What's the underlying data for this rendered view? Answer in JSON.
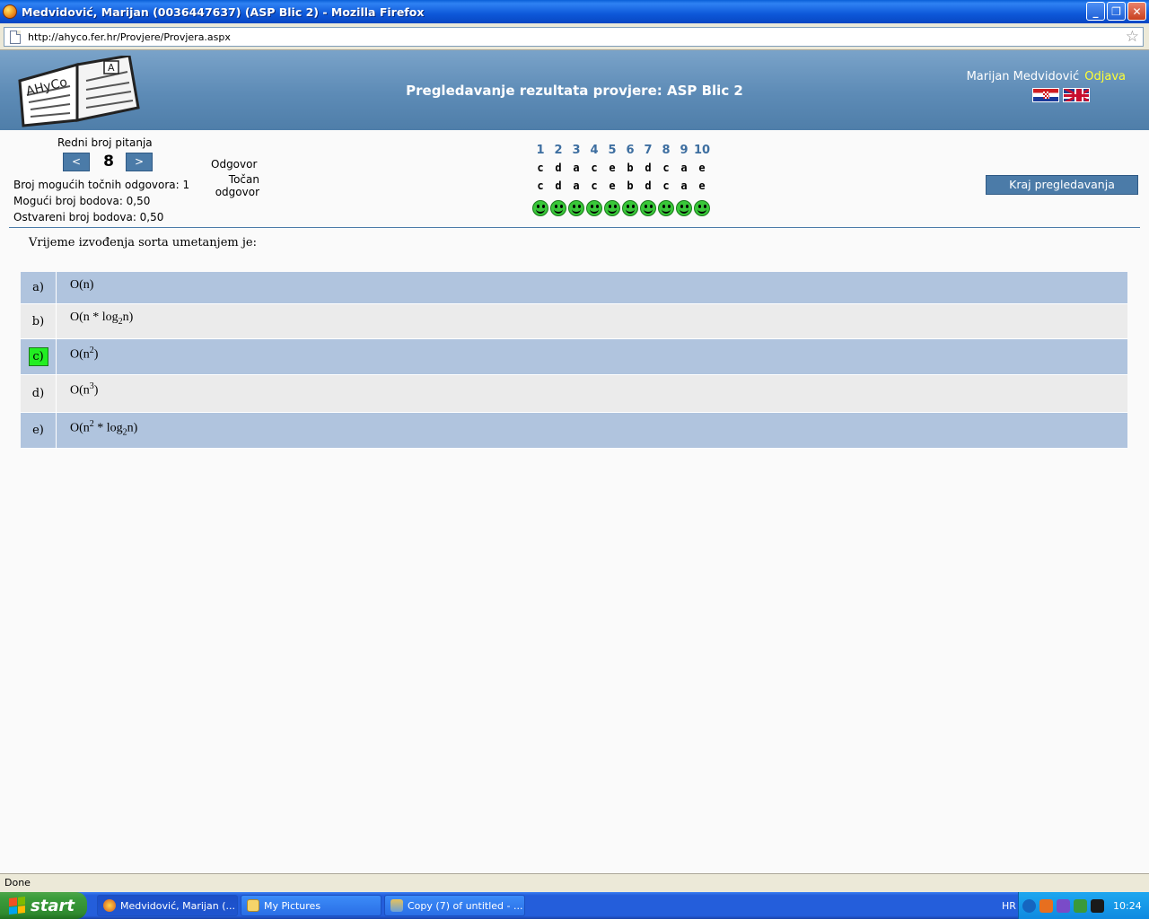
{
  "window": {
    "title": "Medvidović, Marijan (0036447637) (ASP Blic 2) - Mozilla Firefox",
    "minimize": "_",
    "restore": "❐",
    "close": "✕"
  },
  "address_bar": {
    "url": "http://ahyco.fer.hr/Provjere/Provjera.aspx"
  },
  "header": {
    "logo_text": "AHyCo",
    "logo_letter": "A",
    "title": "Pregledavanje rezultata provjere: ASP Blic 2",
    "user_name": "Marijan Medvidović",
    "logout": "Odjava"
  },
  "question_nav": {
    "label": "Redni broj pitanja",
    "prev": "<",
    "next": ">",
    "current": "8",
    "stats": {
      "possible_correct": "Broj mogućih točnih odgovora: 1",
      "possible_points": "Mogući broj bodova: 0,50",
      "achieved_points": "Ostvareni broj bodova: 0,50"
    }
  },
  "answer_grid": {
    "odgovor_label": "Odgovor",
    "tocan_label_line1": "Točan",
    "tocan_label_line2": "odgovor",
    "numbers": [
      "1",
      "2",
      "3",
      "4",
      "5",
      "6",
      "7",
      "8",
      "9",
      "10"
    ],
    "given": [
      "c",
      "d",
      "a",
      "c",
      "e",
      "b",
      "d",
      "c",
      "a",
      "e"
    ],
    "correct": [
      "c",
      "d",
      "a",
      "c",
      "e",
      "b",
      "d",
      "c",
      "a",
      "e"
    ]
  },
  "end_button": "Kraj pregledavanja",
  "question": {
    "text": "Vrijeme izvođenja sorta umetanjem je:",
    "answers": [
      {
        "letter": "a)",
        "text": "O(n)"
      },
      {
        "letter": "b)",
        "text": "O(n * log2n)"
      },
      {
        "letter": "c)",
        "text": "O(n2)"
      },
      {
        "letter": "d)",
        "text": "O(n3)"
      },
      {
        "letter": "e)",
        "text": "O(n2 * log2n)"
      }
    ],
    "answer_parts": {
      "b_pre": "O(n * log",
      "b_sub": "2",
      "b_post": "n)",
      "c_pre": "O(n",
      "c_sup": "2",
      "c_post": ")",
      "d_pre": "O(n",
      "d_sup": "3",
      "d_post": ")",
      "e_pre": "O(n",
      "e_sup": "2",
      "e_mid": " * log",
      "e_sub": "2",
      "e_post": "n)"
    }
  },
  "status": "Done",
  "taskbar": {
    "start": "start",
    "items": [
      "Medvidović, Marijan (...",
      "My Pictures",
      "Copy (7) of untitled - ..."
    ],
    "language": "HR",
    "clock": "10:24"
  },
  "colors": {
    "accent": "#4b7ba8",
    "header_gradient_top": "#7aa3c9",
    "answer_blue": "#b0c4de",
    "answer_gray": "#ebebeb",
    "correct_green": "#22ee22",
    "logout_yellow": "#ffff33"
  }
}
